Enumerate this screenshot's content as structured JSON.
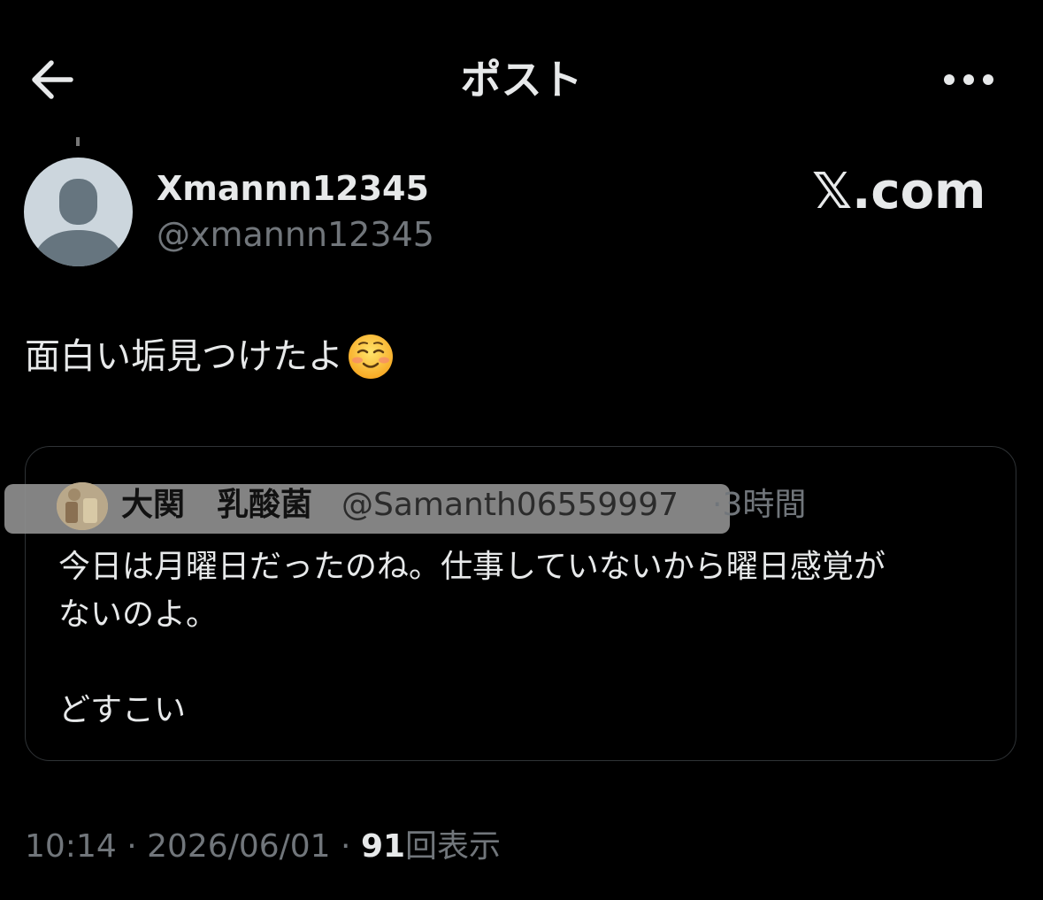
{
  "header": {
    "title": "ポスト",
    "back_icon": "arrow-left-icon",
    "more_icon": "more-horizontal-icon"
  },
  "post": {
    "display_name": "Xmannn12345",
    "handle": "@xmannn12345",
    "watermark": "𝕏.com",
    "text": "面白い垢見つけたよ",
    "emoji": "smiling-face-icon"
  },
  "quote": {
    "name": "大関　乳酸菌",
    "handle": "@Samanth06559997",
    "separator": "·",
    "time": "3時間",
    "lines": [
      "今日は月曜日だったのね。仕事していないから曜日感覚が",
      "ないのよ。",
      "",
      "どすこい"
    ]
  },
  "meta": {
    "time": "10:14",
    "sep1": " · ",
    "date": "2026/06/01",
    "sep2": " · ",
    "views": "91",
    "views_label": "回表示"
  },
  "colors": {
    "background": "#000000",
    "text": "#e7e9ea",
    "muted": "#71767b",
    "border": "#2f3336"
  }
}
